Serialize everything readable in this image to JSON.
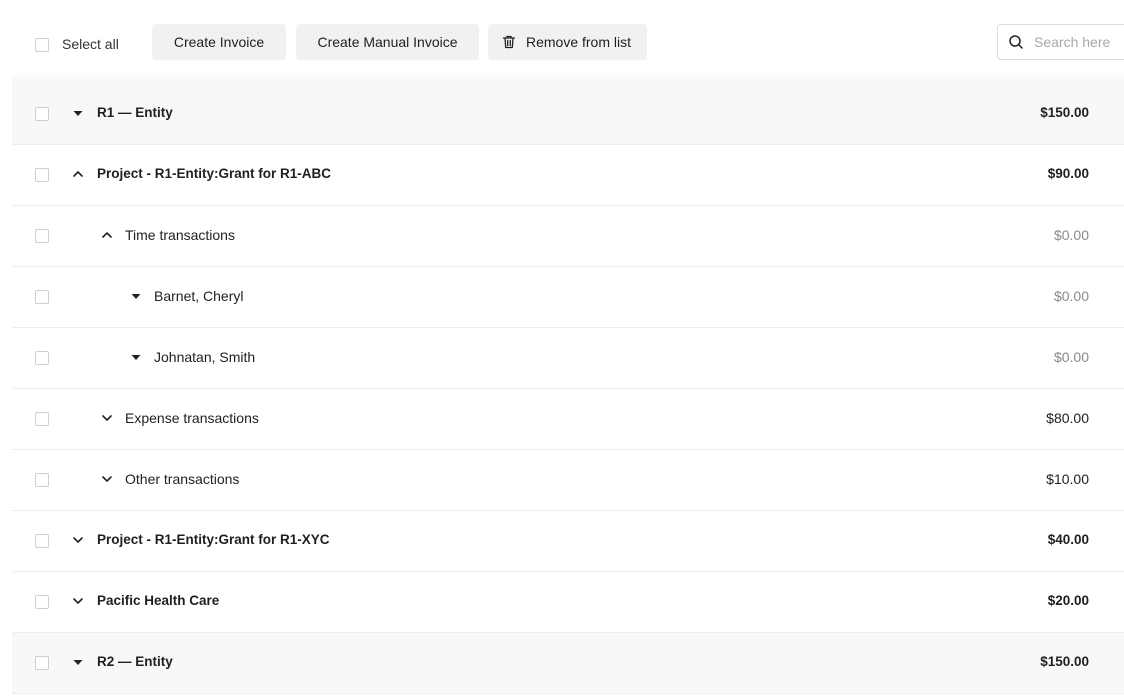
{
  "toolbar": {
    "select_all_label": "Select all",
    "create_invoice_label": "Create Invoice",
    "create_manual_invoice_label": "Create Manual Invoice",
    "remove_from_list_label": "Remove from list",
    "search_placeholder": "Search here"
  },
  "rows": [
    {
      "label": "R1 — Entity",
      "amount": "$150.00",
      "toggle": "caret-down-icon",
      "edge": "T"
    },
    {
      "label": "Project - R1-Entity:Grant for R1-ABC",
      "amount": "$90.00",
      "toggle": "chevron-up-icon"
    },
    {
      "label": "Time transactions",
      "amount": "$0.00",
      "toggle": "chevron-up-icon"
    },
    {
      "label": "Barnet, Cheryl",
      "amount": "$0.00",
      "toggle": "caret-down-icon"
    },
    {
      "label": "Johnatan, Smith",
      "amount": "$0.00",
      "toggle": "caret-down-icon"
    },
    {
      "label": "Expense transactions",
      "amount": "$80.00",
      "toggle": "chevron-down-icon"
    },
    {
      "label": "Other transactions",
      "amount": "$10.00",
      "toggle": "chevron-down-icon"
    },
    {
      "label": "Project - R1-Entity:Grant for R1-XYC",
      "amount": "$40.00",
      "toggle": "chevron-down-icon"
    },
    {
      "label": "Pacific Health Care",
      "amount": "$20.00",
      "toggle": "chevron-down-icon"
    },
    {
      "label": "R2 — Entity",
      "amount": "$150.00",
      "toggle": "caret-down-icon",
      "edge": "T"
    }
  ]
}
